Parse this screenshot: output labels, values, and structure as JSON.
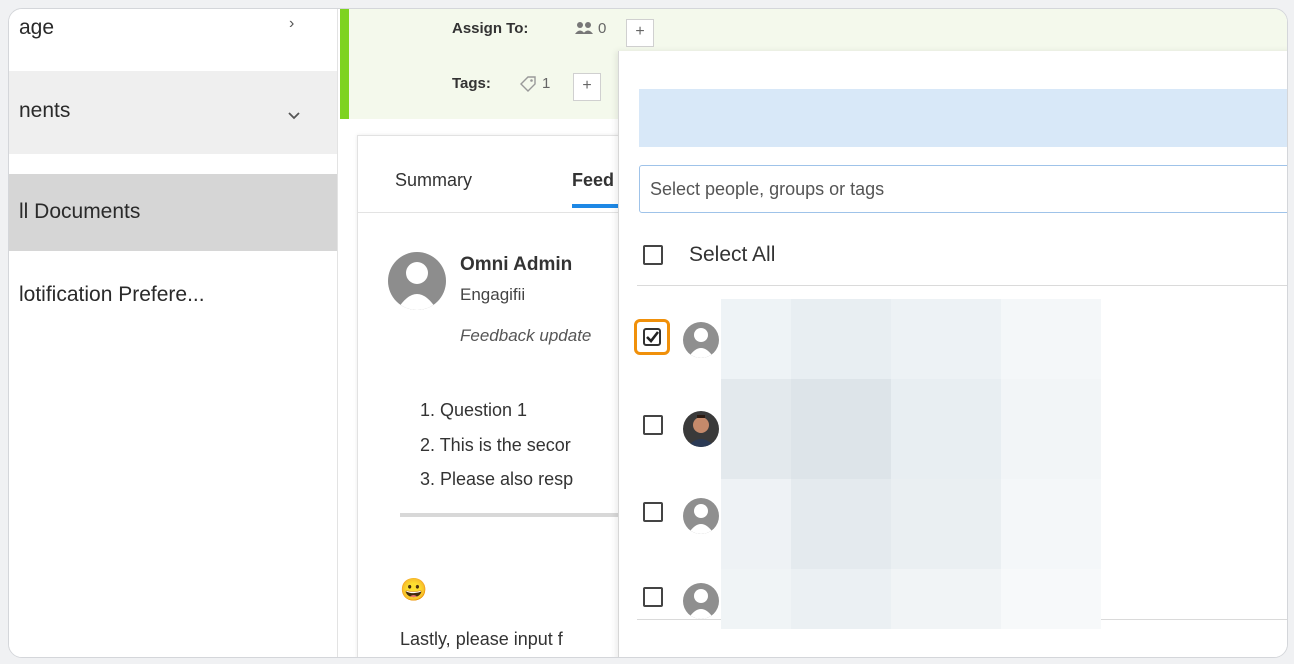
{
  "sidebar": {
    "items": [
      {
        "label": "age"
      },
      {
        "label": "nents"
      },
      {
        "label": "ll Documents"
      },
      {
        "label": "lotification Prefere..."
      }
    ]
  },
  "header": {
    "assign_label": "Assign To:",
    "assign_count": "0",
    "tags_label": "Tags:",
    "tags_count": "1",
    "plus": "+"
  },
  "tabs": [
    {
      "label": "Summary"
    },
    {
      "label": "Feed"
    }
  ],
  "feed": {
    "author": "Omni Admin",
    "org": "Engagifii",
    "note": "Feedback update",
    "list": [
      "1. Question 1",
      "2. This is the secor",
      "3. Please also resp"
    ],
    "emoji": "😀",
    "last_text": "Lastly, please input f"
  },
  "picker": {
    "search_placeholder": "Select people, groups or tags",
    "select_all": "Select All"
  },
  "colors": {
    "accent_green": "#7ed321",
    "accent_blue": "#1e88e5",
    "highlight_orange": "#f0900a"
  }
}
